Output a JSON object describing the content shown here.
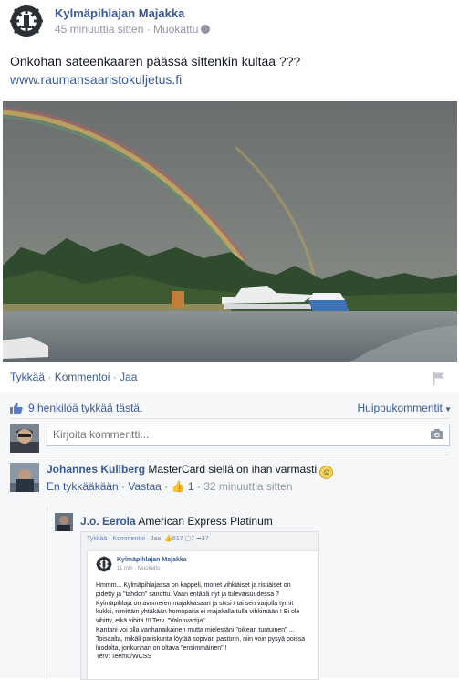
{
  "page": {
    "name": "Kylmäpihlajan Majakka",
    "meta": "45 minuuttia sitten · Muokattu"
  },
  "post": {
    "text": "Onkohan sateenkaaren päässä sittenkin kultaa ???",
    "link": "www.raumansaaristokuljetus.fi"
  },
  "actions": {
    "like": "Tykkää",
    "comment": "Kommentoi",
    "share": "Jaa"
  },
  "feedback": {
    "likes_text": "9 henkilöä tykkää tästä.",
    "top_comments": "Huippukommentit",
    "comment_placeholder": "Kirjoita kommentti..."
  },
  "comments": [
    {
      "author": "Johannes Kullberg",
      "text": "MasterCard siellä on ihan varmasti",
      "unlike": "En tykkääkään",
      "reply": "Vastaa",
      "like_count": "1",
      "time": "32 minuuttia sitten"
    }
  ],
  "reply": {
    "author": "J.o. Eerola",
    "text": "American Express Platinum"
  },
  "embedded_screenshot": {
    "bar": "Tykkää · Kommentoi · Jaa",
    "counts": "617",
    "comments_count": "7",
    "shares_count": "37",
    "page_name": "Kylmäpihlajan Majakka",
    "meta": "11 min · Muokattu",
    "lines": [
      "Hmmm... Kylmäpihlajassa on kappeli, monet vihkiäiset ja ristiäiset on",
      "pidetty ja \"tahdon\" sanottu. Vaan entäpä nyt ja tulevaisuudessa ?",
      "Kylmäpihlaja on avomeren majakkasaari ja siksi / tai sen varjolla tyrnit",
      "kukkii, nimittäin yhtäkään homoparia ei majakalla tulla vihkimään ! Ei ole",
      "vihitty, eikä vihitä !!! Terv. \"Valonvartija\"...",
      "Kantani voi olla vanhanaikainen mutta mielestäni \"oikean tuntuinen\" ...",
      "Toisaalta, mikäli pariskunta löytää sopivan pastorin, niin voin pysyä poissa",
      "luodolta, jonkunhan on oltava \"ensimmäinen\" !",
      "Terv: Teemu/WCSS"
    ]
  },
  "colors": {
    "link": "#3b5998",
    "meta": "#9197a3",
    "feedback_bg": "#f6f7f8"
  }
}
